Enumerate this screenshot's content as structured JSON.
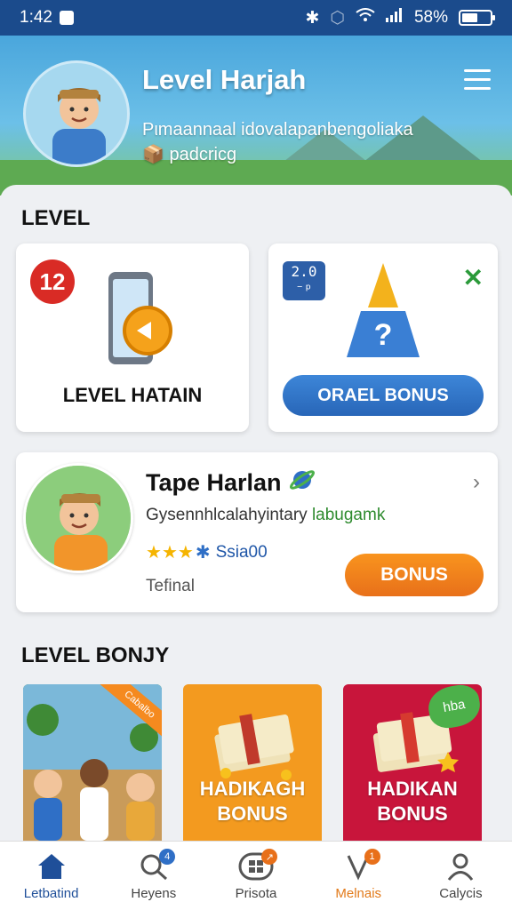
{
  "status_bar": {
    "time": "1:42",
    "battery": "58%",
    "battery_level": 0.58
  },
  "header": {
    "title": "Level Harjah",
    "subtitle_line1": "Pιmaannaal idovalapanbengoliaka",
    "subtitle_line2": "padcricg",
    "menu_icon": "hamburger-menu-icon"
  },
  "level_section": {
    "title": "LEVEL",
    "card_left": {
      "badge": "12",
      "label": "LEVEL HATAIN",
      "icon": "phone-coin-icon"
    },
    "card_right": {
      "badge": "2.0\n⁻ᵖ",
      "button": "ORAEL BONUS",
      "icon": "mystery-box-icon",
      "close_icon": "close-icon"
    }
  },
  "profile_card": {
    "name": "Tape Harlan",
    "description": "Gysennhlcalahyintary",
    "description_highlight": "labugamk",
    "stars": 3,
    "rating_label": "Ssia00",
    "subtext": "Tefinal",
    "button": "BONUS"
  },
  "bonus_section": {
    "title": "LEVEL BONJY",
    "tiles": [
      {
        "kind": "photo",
        "ribbon": "Cabalbo",
        "color": "#4f8f3c"
      },
      {
        "line1": "HADIKAGH",
        "line2": "BONUS",
        "color": "#f39a1f"
      },
      {
        "line1": "HADIKAN",
        "line2": "BONUS",
        "color": "#c8153b",
        "badge": "hba"
      }
    ]
  },
  "bottom_nav": [
    {
      "label": "Letbatind",
      "icon": "home-icon",
      "active": true
    },
    {
      "label": "Heyens",
      "icon": "search-icon",
      "badge": "4"
    },
    {
      "label": "Prisota",
      "icon": "grid-icon",
      "badge": "↗"
    },
    {
      "label": "Melnais",
      "icon": "gift-icon",
      "badge": "1"
    },
    {
      "label": "Calycis",
      "icon": "profile-icon"
    }
  ]
}
